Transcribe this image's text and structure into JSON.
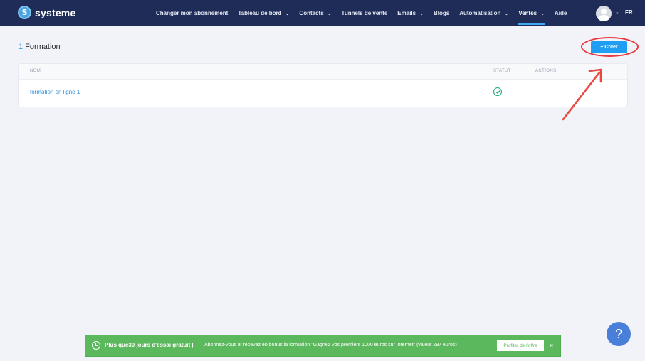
{
  "brand": {
    "name": "systeme"
  },
  "nav": {
    "items": [
      {
        "label": "Changer mon abonnement",
        "dropdown": false,
        "active": false
      },
      {
        "label": "Tableau de bord",
        "dropdown": true,
        "active": false
      },
      {
        "label": "Contacts",
        "dropdown": true,
        "active": false
      },
      {
        "label": "Tunnels de vente",
        "dropdown": false,
        "active": false
      },
      {
        "label": "Emails",
        "dropdown": true,
        "active": false
      },
      {
        "label": "Blogs",
        "dropdown": false,
        "active": false
      },
      {
        "label": "Automatisation",
        "dropdown": true,
        "active": false
      },
      {
        "label": "Ventes",
        "dropdown": true,
        "active": true
      },
      {
        "label": "Aide",
        "dropdown": false,
        "active": false
      }
    ],
    "language": "FR"
  },
  "page": {
    "count": "1",
    "title": "Formation",
    "create_label": "+ Créer"
  },
  "table": {
    "headers": {
      "name": "NOM",
      "status": "STATUT",
      "actions": "ACTIONS"
    },
    "rows": [
      {
        "name": "formation en ligne 1",
        "status": "active"
      }
    ]
  },
  "banner": {
    "title": "Plus que30 jours d'essai gratuit |",
    "text": "Abonnez-vous et recevez en bonus la formation \"Gagnez vos premiers 1000 euros sur Internet\" (valeur 297 euros)",
    "offer_label": "Profiter de l'offre",
    "close_label": "×"
  },
  "help": {
    "label": "?"
  },
  "colors": {
    "nav_bg": "#1e2c57",
    "accent": "#1f9ef3",
    "banner_bg": "#5cb85c",
    "status_ok": "#17a57a",
    "annotation": "#e8383d"
  }
}
